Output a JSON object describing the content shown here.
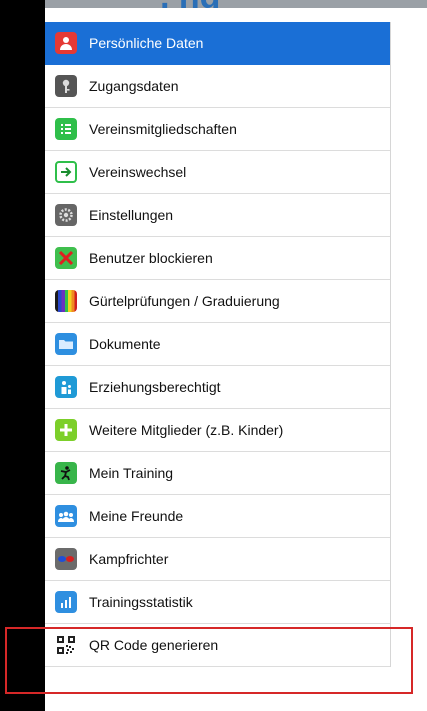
{
  "header": {
    "title_fragment": ", ng"
  },
  "menu": {
    "items": [
      {
        "label": "Persönliche Daten",
        "icon": "person-icon",
        "selected": true
      },
      {
        "label": "Zugangsdaten",
        "icon": "key-icon"
      },
      {
        "label": "Vereinsmitgliedschaften",
        "icon": "membership-list-icon"
      },
      {
        "label": "Vereinswechsel",
        "icon": "arrow-right-box-icon"
      },
      {
        "label": "Einstellungen",
        "icon": "gear-icon"
      },
      {
        "label": "Benutzer blockieren",
        "icon": "block-x-icon"
      },
      {
        "label": "Gürtelprüfungen / Graduierung",
        "icon": "belt-colors-icon"
      },
      {
        "label": "Dokumente",
        "icon": "folder-icon"
      },
      {
        "label": "Erziehungsberechtigt",
        "icon": "parent-child-icon"
      },
      {
        "label": "Weitere Mitglieder (z.B. Kinder)",
        "icon": "plus-icon"
      },
      {
        "label": "Mein Training",
        "icon": "training-figure-icon"
      },
      {
        "label": "Meine Freunde",
        "icon": "friends-icon"
      },
      {
        "label": "Kampfrichter",
        "icon": "referee-icon"
      },
      {
        "label": "Trainingsstatistik",
        "icon": "bar-chart-icon"
      },
      {
        "label": "QR Code generieren",
        "icon": "qr-code-icon"
      }
    ]
  },
  "colors": {
    "selected": "#1a6fd6",
    "highlight": "#d62828"
  }
}
